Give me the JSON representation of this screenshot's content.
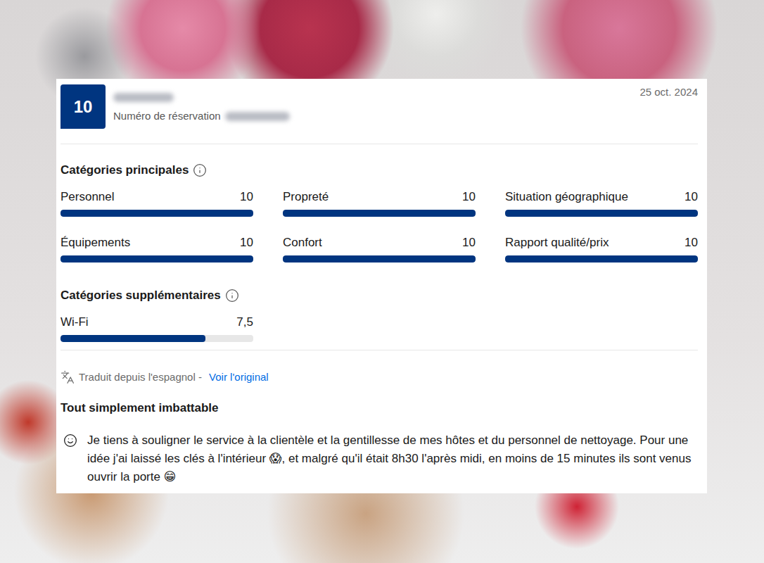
{
  "review": {
    "score": "10",
    "reservation_label": "Numéro de réservation",
    "date": "25 oct. 2024"
  },
  "main_categories": {
    "heading": "Catégories principales",
    "items": [
      {
        "label": "Personnel",
        "score": "10",
        "level": 1
      },
      {
        "label": "Propreté",
        "score": "10",
        "level": 1
      },
      {
        "label": "Situation géographique",
        "score": "10",
        "level": 1
      },
      {
        "label": "Équipements",
        "score": "10",
        "level": 1
      },
      {
        "label": "Confort",
        "score": "10",
        "level": 1
      },
      {
        "label": "Rapport qualité/prix",
        "score": "10",
        "level": 1
      }
    ]
  },
  "extra_categories": {
    "heading": "Catégories supplémentaires",
    "items": [
      {
        "label": "Wi-Fi",
        "score": "7,5",
        "level": 0.75
      }
    ]
  },
  "translation": {
    "note": "Traduit depuis l'espagnol - ",
    "link": "Voir l'original"
  },
  "title": "Tout simplement imbattable",
  "body": "Je tiens à souligner le service à la clientèle et la gentillesse de mes hôtes et du personnel de nettoyage. Pour une idée j'ai laissé les clés à l'intérieur 😱, et malgré qu'il était 8h30 l'après midi, en moins de 15 minutes ils sont venus ouvrir la porte 😁"
}
